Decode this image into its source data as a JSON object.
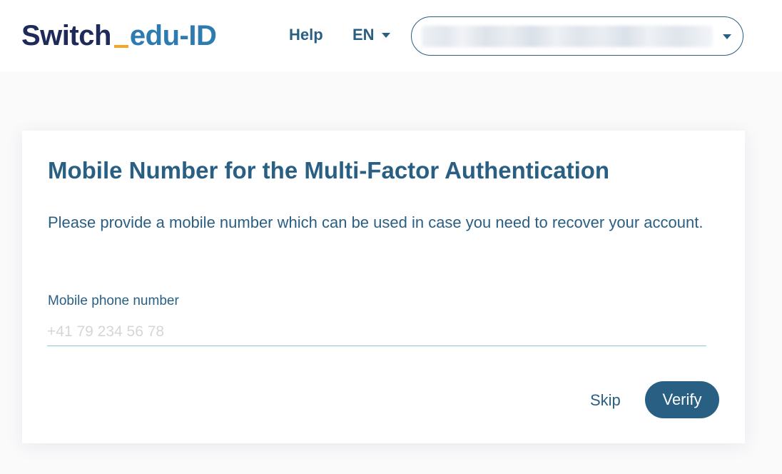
{
  "header": {
    "logo": {
      "part1": "Switch",
      "part2": "edu-ID",
      "accent_color": "#f5a623",
      "primary_color": "#1e2a5a",
      "secondary_color": "#2d7bb0"
    },
    "help_label": "Help",
    "language": "EN",
    "account_menu_icon": "chevron-down-icon"
  },
  "card": {
    "title": "Mobile Number for the Multi-Factor Authentication",
    "description": "Please provide a mobile number which can be used in case you need to recover your account.",
    "phone_field": {
      "label": "Mobile phone number",
      "value": "",
      "placeholder": "+41 79 234 56 78"
    },
    "skip_label": "Skip",
    "verify_label": "Verify"
  },
  "colors": {
    "brand": "#2a5f84",
    "input_underline": "#8ccbd8",
    "placeholder": "#d3d6da"
  }
}
